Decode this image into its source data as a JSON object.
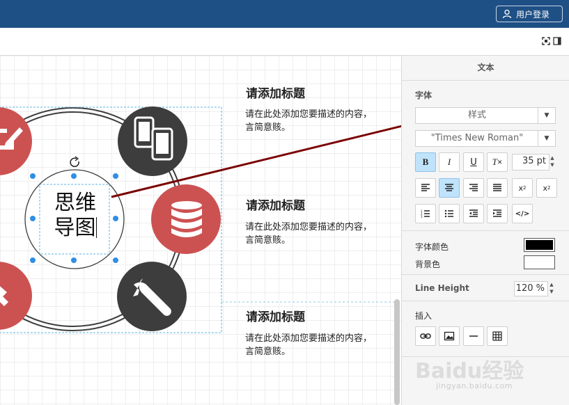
{
  "header": {
    "login_label": "用户登录"
  },
  "panel": {
    "title": "文本",
    "font_section": "字体",
    "style_dropdown": "样式",
    "font_family": "\"Times New Roman\"",
    "font_size": "35 pt",
    "font_color_label": "字体颜色",
    "bg_color_label": "背景色",
    "font_color": "#000000",
    "bg_color": "#ffffff",
    "line_height_label": "Line Height",
    "line_height": "120 %",
    "insert_label": "插入"
  },
  "canvas": {
    "mindmap_line1": "思维",
    "mindmap_line2": "导图",
    "items": [
      {
        "title": "请添加标题",
        "desc": "请在此处添加您要描述的内容，言简意赅。"
      },
      {
        "title": "请添加标题",
        "desc": "请在此处添加您要描述的内容，言简意赅。"
      },
      {
        "title": "请添加标题",
        "desc": "请在此处添加您要描述的内容，言简意赅。"
      }
    ]
  },
  "watermark": {
    "brand": "Baidu经验",
    "url": "jingyan.baidu.com"
  },
  "colors": {
    "header": "#1f5085",
    "red_node": "#cc5252",
    "dark_node": "#3d3d3d",
    "arrow": "#7a0000",
    "selection": "#2f8ee6"
  }
}
